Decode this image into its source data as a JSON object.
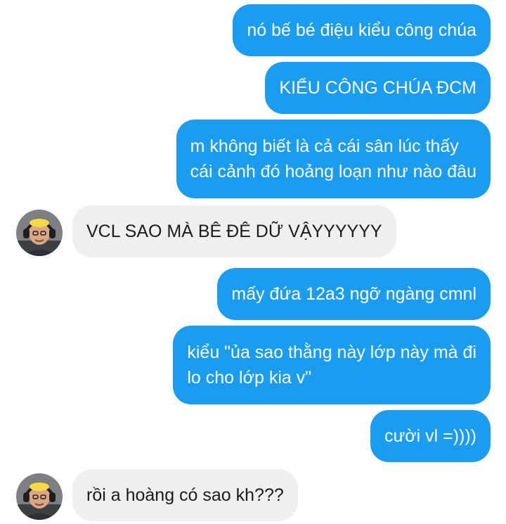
{
  "colors": {
    "outgoing_bubble": "#1a9cf0",
    "incoming_bubble": "#efeff1",
    "outgoing_text": "#ffffff",
    "incoming_text": "#1c1c1c"
  },
  "contact": {
    "avatar_icon": "profile-photo-avatar-with-headphones"
  },
  "messages": [
    {
      "direction": "outgoing",
      "lines": [
        "nó bế bé điệu kiểu công chúa"
      ]
    },
    {
      "direction": "outgoing",
      "lines": [
        "KIỂU CÔNG CHÚA ĐCM"
      ]
    },
    {
      "direction": "outgoing",
      "lines": [
        "m không biết là cả cái sân lúc thấy",
        "cái cảnh đó hoảng loạn như nào đâu"
      ]
    },
    {
      "direction": "incoming",
      "lines": [
        "VCL SAO MÀ BÊ ĐÊ DỮ VẬYYYYYY"
      ]
    },
    {
      "direction": "outgoing",
      "lines": [
        "mấy đứa 12a3 ngỡ ngàng cmnl"
      ]
    },
    {
      "direction": "outgoing",
      "lines": [
        "kiểu \"ủa sao thằng này lớp này mà đi",
        "lo cho lớp kia v\""
      ]
    },
    {
      "direction": "outgoing",
      "lines": [
        "cười vl =))))"
      ]
    },
    {
      "direction": "incoming",
      "lines": [
        "rồi a hoàng có sao kh???"
      ]
    }
  ]
}
